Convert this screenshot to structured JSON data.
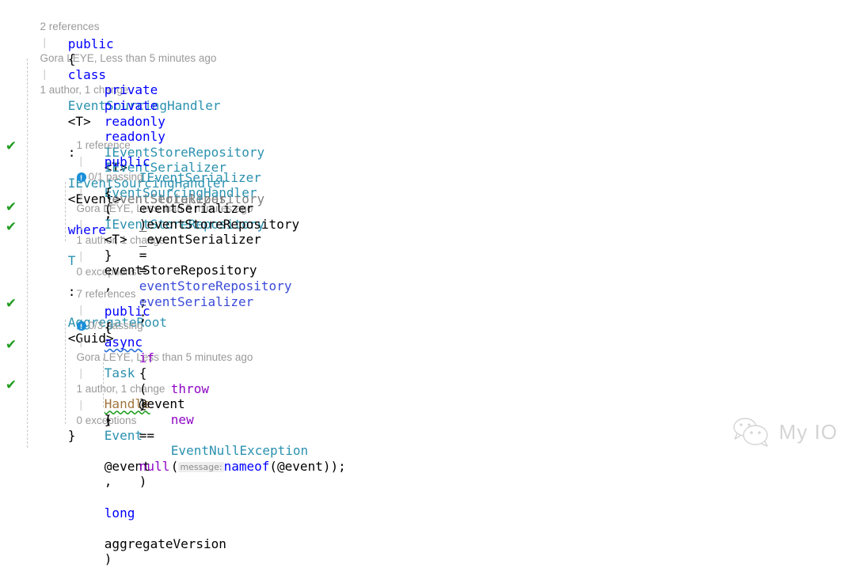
{
  "editor": {
    "language": "csharp",
    "theme": "light",
    "colors": {
      "background": "#ffffff",
      "keyword": "#0000ff",
      "type": "#2b91af",
      "control_keyword": "#8f08c4",
      "parameter": "#3a4bd8",
      "unused_field": "#808080",
      "method": "#a0763c",
      "codelens_text": "#9a9a9a",
      "test_pass_check": "#1f9d1f",
      "codelens_icon": "#1a8fd8",
      "indent_guide": "#c8c8c8"
    }
  },
  "codelens": {
    "class": {
      "references": "2 references",
      "author_and_time": "Gora LEYE, Less than 5 minutes ago",
      "changes": "1 author, 1 change"
    },
    "constructor": {
      "references": "1 reference",
      "test_icon": "test-status-icon",
      "passing": "0/1 passing",
      "author_and_time": "Gora LEYE, Less than 5 minutes ago",
      "changes": "1 author, 1 change",
      "exceptions": "0 exceptions"
    },
    "handle_method": {
      "references": "7 references",
      "test_icon": "test-status-icon",
      "passing": "0/3 passing",
      "author_and_time": "Gora LEYE, Less than 5 minutes ago",
      "changes": "1 author, 1 change",
      "exceptions": "0 exceptions"
    },
    "separator": "|"
  },
  "gutter": {
    "glyph": "✔",
    "marks": [
      {
        "line": "constructor-signature",
        "status": "covered"
      },
      {
        "line": "assign-event-store-repository",
        "status": "covered"
      },
      {
        "line": "assign-event-serializer",
        "status": "covered"
      },
      {
        "line": "handle-signature",
        "status": "covered"
      },
      {
        "line": "null-check-if",
        "status": "covered"
      },
      {
        "line": "throw-event-null-exception",
        "status": "covered"
      }
    ]
  },
  "code": {
    "class_declaration": {
      "kw_public": "public",
      "kw_class": "class",
      "class_name": "EventSourcingHandler",
      "generic_t": "<T>",
      "colon": ":",
      "base_interface": "IEventSourcingHandler",
      "base_generic": "<Event>",
      "kw_where": "where",
      "constraint_t": "T",
      "constraint_colon": ":",
      "constraint_type": "AggregateRoot",
      "constraint_generic": "<Guid>"
    },
    "open_brace": "{",
    "close_brace": "}",
    "field_repository": {
      "kw_private": "private",
      "kw_readonly": "readonly",
      "type": "IEventStoreRepository",
      "generic": "<T>",
      "name": "_eventStoreRepository",
      "semicolon": ";"
    },
    "field_serializer": {
      "kw_private": "private",
      "kw_readonly": "readonly",
      "type": "IEventSerializer",
      "name": "_eventSerializer",
      "semicolon": ";"
    },
    "constructor": {
      "kw_public": "public",
      "name": "EventSourcingHandler",
      "open_paren": "(",
      "param1_type": "IEventStoreRepository",
      "param1_generic": "<T>",
      "param1_name": "eventStoreRepository",
      "comma": ",",
      "param2_type": "IEventSerializer",
      "param2_name": "eventSerializer",
      "close_paren": ")"
    },
    "assign_repository": {
      "target": "_eventStoreRepository",
      "operator": "=",
      "value": "eventStoreRepository",
      "semicolon": ";"
    },
    "assign_serializer": {
      "target": "_eventSerializer",
      "operator": "=",
      "value": "eventSerializer",
      "semicolon": ";"
    },
    "handle_method": {
      "kw_public": "public",
      "kw_async": "async",
      "return_type": "Task",
      "name": "Handle",
      "open_paren": "(",
      "param1_type": "Event",
      "param1_name": "@event",
      "comma": ",",
      "param2_type": "long",
      "param2_name": "aggregateVersion",
      "close_paren": ")"
    },
    "null_check": {
      "kw_if": "if",
      "open_paren": "(",
      "subject": "@event",
      "operator": "==",
      "kw_null": "null",
      "close_paren": ")"
    },
    "throw_statement": {
      "kw_throw": "throw",
      "kw_new": "new",
      "exception_type": "EventNullException",
      "open_paren": "(",
      "param_hint": "message:",
      "nameof": "nameof",
      "nameof_open": "(",
      "nameof_arg": "@event",
      "nameof_close": ")",
      "close_paren": ")",
      "semicolon": ";"
    }
  },
  "watermark": {
    "icon": "wechat-logo-icon",
    "label": "My IO"
  }
}
